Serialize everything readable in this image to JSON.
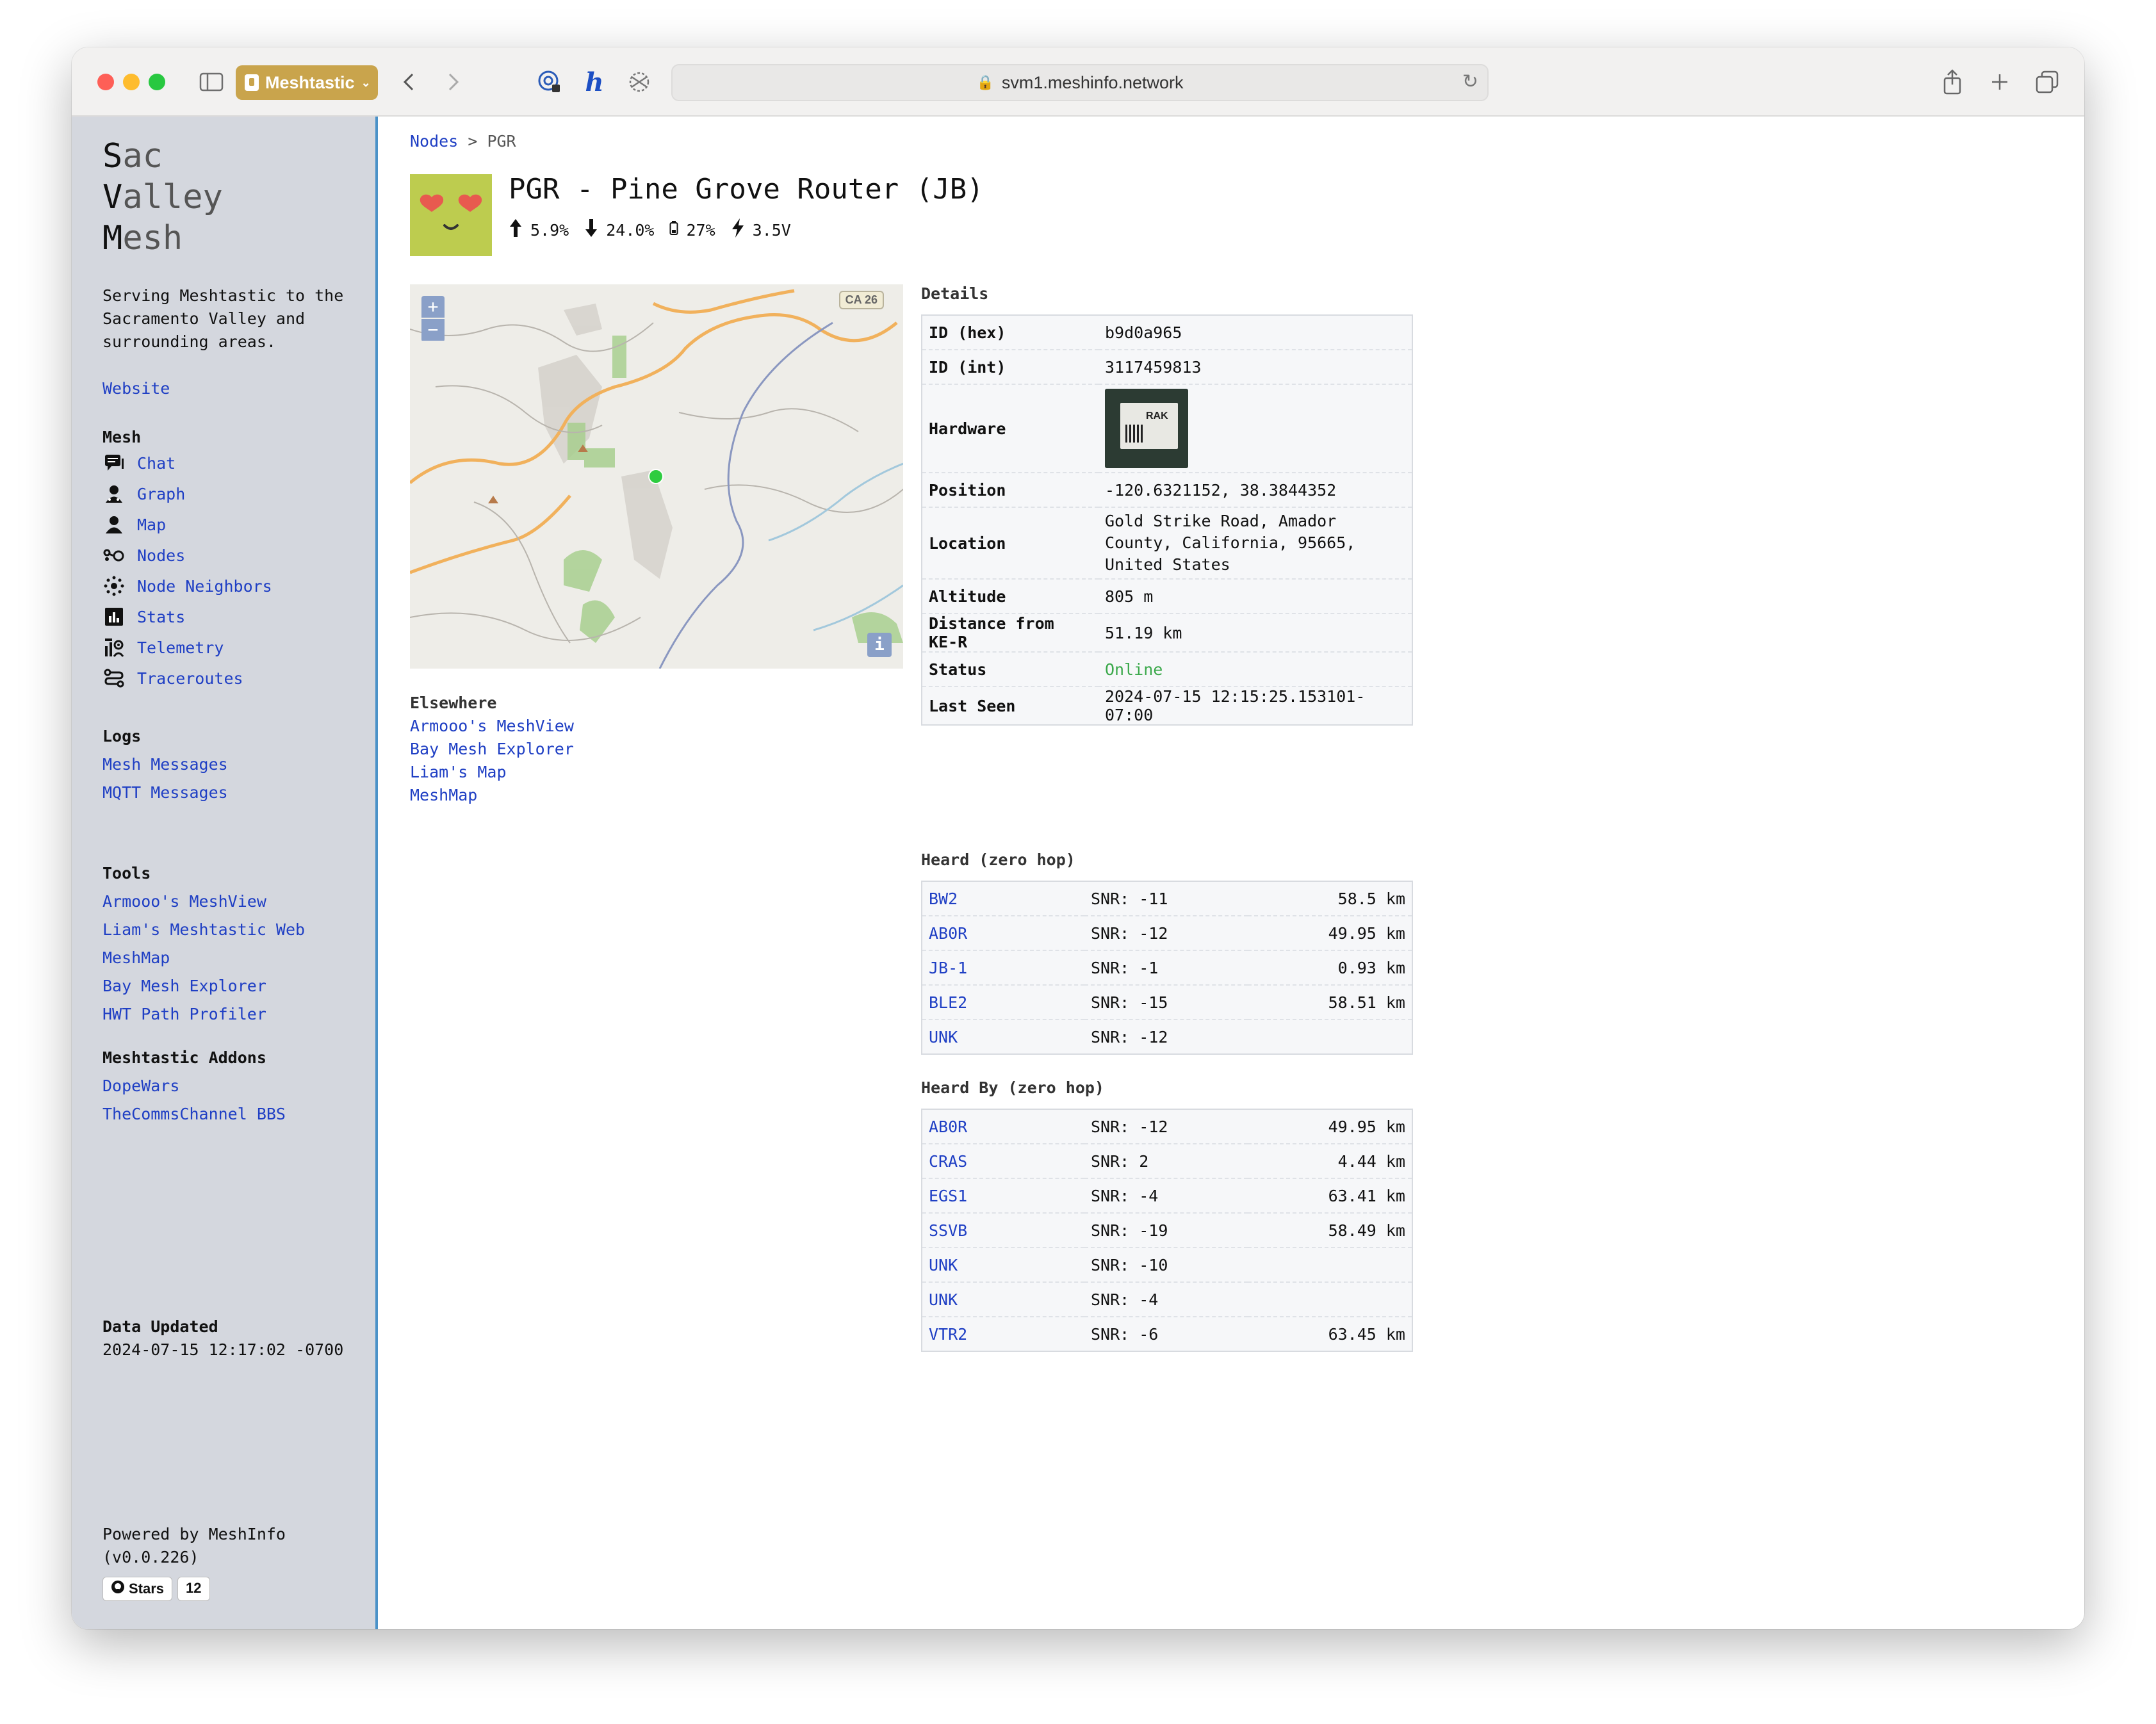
{
  "browser": {
    "tab_label": "Meshtastic",
    "url": "svm1.meshinfo.network"
  },
  "sidebar": {
    "logo": [
      {
        "cap": "S",
        "rest": "ac"
      },
      {
        "cap": "V",
        "rest": "alley"
      },
      {
        "cap": "M",
        "rest": "esh"
      }
    ],
    "tagline": "Serving Meshtastic to the Sacramento Valley and surrounding areas.",
    "website": "Website",
    "mesh_title": "Mesh",
    "mesh_items": [
      {
        "label": "Chat",
        "icon": "chat-icon"
      },
      {
        "label": "Graph",
        "icon": "graph-icon"
      },
      {
        "label": "Map",
        "icon": "map-icon"
      },
      {
        "label": "Nodes",
        "icon": "nodes-icon"
      },
      {
        "label": "Node Neighbors",
        "icon": "neighbors-icon"
      },
      {
        "label": "Stats",
        "icon": "stats-icon"
      },
      {
        "label": "Telemetry",
        "icon": "telemetry-icon"
      },
      {
        "label": "Traceroutes",
        "icon": "traceroutes-icon"
      }
    ],
    "logs_title": "Logs",
    "logs_items": [
      "Mesh Messages",
      "MQTT Messages"
    ],
    "tools_title": "Tools",
    "tools_items": [
      "Armooo's MeshView",
      "Liam's Meshtastic Web",
      "MeshMap",
      "Bay Mesh Explorer",
      "HWT Path Profiler"
    ],
    "addons_title": "Meshtastic Addons",
    "addons_items": [
      "DopeWars",
      "TheCommsChannel BBS"
    ],
    "updated_label": "Data Updated",
    "updated_value": "2024-07-15 12:17:02 -0700",
    "powered_label": "Powered by MeshInfo",
    "version": "(v0.0.226)",
    "gh_stars_label": "Stars",
    "gh_stars_count": "12"
  },
  "main": {
    "breadcrumb": {
      "root": "Nodes",
      "sep": ">",
      "current": "PGR"
    },
    "title": "PGR - Pine Grove Router (JB)",
    "stats": {
      "up": "5.9%",
      "down": "24.0%",
      "battery": "27%",
      "voltage": "3.5V"
    },
    "map": {
      "zoom_in": "+",
      "zoom_out": "−",
      "info": "i",
      "road_shield": "CA 26"
    },
    "elsewhere_title": "Elsewhere",
    "elsewhere_items": [
      "Armooo's MeshView",
      "Bay Mesh Explorer",
      "Liam's Map",
      "MeshMap"
    ],
    "details_title": "Details",
    "details": {
      "id_hex_label": "ID (hex)",
      "id_hex": "b9d0a965",
      "id_int_label": "ID (int)",
      "id_int": "3117459813",
      "hardware_label": "Hardware",
      "hardware_brand": "RAK",
      "position_label": "Position",
      "position": "-120.6321152, 38.3844352",
      "location_label": "Location",
      "location": "Gold Strike Road, Amador County, California, 95665, United States",
      "altitude_label": "Altitude",
      "altitude": "805 m",
      "distance_label": "Distance from KE-R",
      "distance": "51.19 km",
      "status_label": "Status",
      "status": "Online",
      "last_seen_label": "Last Seen",
      "last_seen": "2024-07-15 12:15:25.153101-07:00"
    },
    "heard_title": "Heard (zero hop)",
    "heard": [
      {
        "node": "BW2",
        "snr": "SNR: -11",
        "dist": "58.5 km"
      },
      {
        "node": "AB0R",
        "snr": "SNR: -12",
        "dist": "49.95 km"
      },
      {
        "node": "JB-1",
        "snr": "SNR: -1",
        "dist": "0.93 km"
      },
      {
        "node": "BLE2",
        "snr": "SNR: -15",
        "dist": "58.51 km"
      },
      {
        "node": "UNK",
        "snr": "SNR: -12",
        "dist": ""
      }
    ],
    "heard_by_title": "Heard By (zero hop)",
    "heard_by": [
      {
        "node": "AB0R",
        "snr": "SNR: -12",
        "dist": "49.95 km"
      },
      {
        "node": "CRAS",
        "snr": "SNR: 2",
        "dist": "4.44 km"
      },
      {
        "node": "EGS1",
        "snr": "SNR: -4",
        "dist": "63.41 km"
      },
      {
        "node": "SSVB",
        "snr": "SNR: -19",
        "dist": "58.49 km"
      },
      {
        "node": "UNK",
        "snr": "SNR: -10",
        "dist": ""
      },
      {
        "node": "UNK",
        "snr": "SNR: -4",
        "dist": ""
      },
      {
        "node": "VTR2",
        "snr": "SNR: -6",
        "dist": "63.45 km"
      }
    ]
  },
  "colors": {
    "link": "#1f3fc4",
    "online": "#3aa84a",
    "sidebar_bg": "#d4d7de",
    "sidebar_border": "#4b92c8",
    "avatar_bg": "#bdcc4f",
    "tab_accent": "#c9a44c"
  }
}
